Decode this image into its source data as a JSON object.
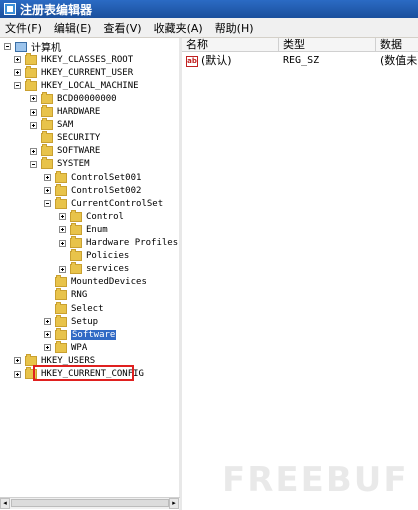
{
  "window": {
    "title": "注册表编辑器"
  },
  "menu": [
    "文件(F)",
    "编辑(E)",
    "查看(V)",
    "收藏夹(A)",
    "帮助(H)"
  ],
  "list": {
    "columns": [
      "名称",
      "类型",
      "数据"
    ],
    "rows": [
      {
        "name": "(默认)",
        "type": "REG_SZ",
        "data": "(数值未"
      }
    ]
  },
  "tree": [
    {
      "label": "计算机",
      "icon": "computer-icon",
      "expander": "minus"
    },
    {
      "label": "HKEY_CLASSES_ROOT",
      "expander": "plus"
    },
    {
      "label": "HKEY_CURRENT_USER",
      "expander": "plus"
    },
    {
      "label": "HKEY_LOCAL_MACHINE",
      "expander": "minus"
    },
    {
      "label": "BCD00000000",
      "expander": "plus"
    },
    {
      "label": "HARDWARE",
      "expander": "plus"
    },
    {
      "label": "SAM",
      "expander": "plus"
    },
    {
      "label": "SECURITY",
      "expander": "none"
    },
    {
      "label": "SOFTWARE",
      "expander": "plus"
    },
    {
      "label": "SYSTEM",
      "expander": "minus"
    },
    {
      "label": "ControlSet001",
      "expander": "plus"
    },
    {
      "label": "ControlSet002",
      "expander": "plus"
    },
    {
      "label": "CurrentControlSet",
      "expander": "minus"
    },
    {
      "label": "Control",
      "expander": "plus"
    },
    {
      "label": "Enum",
      "expander": "plus"
    },
    {
      "label": "Hardware Profiles",
      "expander": "plus"
    },
    {
      "label": "Policies",
      "expander": "none"
    },
    {
      "label": "services",
      "expander": "plus"
    },
    {
      "label": "MountedDevices",
      "expander": "none"
    },
    {
      "label": "RNG",
      "expander": "none"
    },
    {
      "label": "Select",
      "expander": "none"
    },
    {
      "label": "Setup",
      "expander": "plus"
    },
    {
      "label": "Software",
      "expander": "plus",
      "selected": true
    },
    {
      "label": "WPA",
      "expander": "plus"
    },
    {
      "label": "HKEY_USERS",
      "expander": "plus"
    },
    {
      "label": "HKEY_CURRENT_CONFIG",
      "expander": "plus"
    }
  ],
  "watermark": "FREEBUF",
  "colors": {
    "highlight": "#e0201f",
    "selection": "#316ac5"
  }
}
